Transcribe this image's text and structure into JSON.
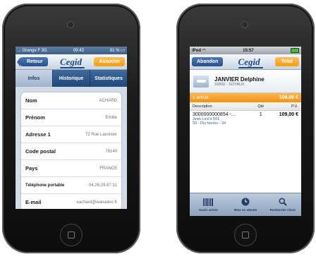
{
  "phone1": {
    "status": {
      "carrier": "... Orange F  3G",
      "time": "09:43",
      "battery": "81 %"
    },
    "nav": {
      "back_label": "Retour",
      "logo": "Cegid",
      "action_label": "Associer"
    },
    "tabs": [
      {
        "label": "Infos",
        "active": true
      },
      {
        "label": "Historique",
        "active": false
      },
      {
        "label": "Statistiques",
        "active": false
      }
    ],
    "fields": [
      {
        "label": "Nom",
        "value": "ACHARD",
        "small": false
      },
      {
        "label": "Prénom",
        "value": "Emilie",
        "small": false
      },
      {
        "label": "Adresse 1",
        "value": "72 Rue Lavoisier",
        "small": false
      },
      {
        "label": "Code postal",
        "value": "78140",
        "small": false
      },
      {
        "label": "Pays",
        "value": "FRANCE",
        "small": false
      },
      {
        "label": "Téléphone portable",
        "value": "04.26.29.87.31",
        "small": true
      },
      {
        "label": "E-mail",
        "value": "eachard@wanadoo.fr",
        "small": false
      }
    ]
  },
  "phone2": {
    "status": {
      "device": "iPod",
      "time": "15:57"
    },
    "nav": {
      "left_label": "Abandon",
      "logo": "Cegid",
      "right_label": "Total"
    },
    "customer": {
      "name": "JANVIER Delphine",
      "city": "16800 - SOYAUX"
    },
    "summary": {
      "count_label": "1 article",
      "total": "109,00 €"
    },
    "columns": {
      "description": "Description",
      "qty": "Qté",
      "unit_price": "P.U."
    },
    "items": [
      {
        "code": "3000000000854 -...",
        "name": "Jean Levi's 501",
        "detail": "33 - Dry bones - 34",
        "qty": "1",
        "price": "109,00 €"
      }
    ],
    "toolbar": [
      {
        "label": "Saisir article",
        "icon": "barcode-icon"
      },
      {
        "label": "Mise en attente",
        "icon": "clock-icon"
      },
      {
        "label": "Recherche client",
        "icon": "search-icon"
      }
    ]
  }
}
